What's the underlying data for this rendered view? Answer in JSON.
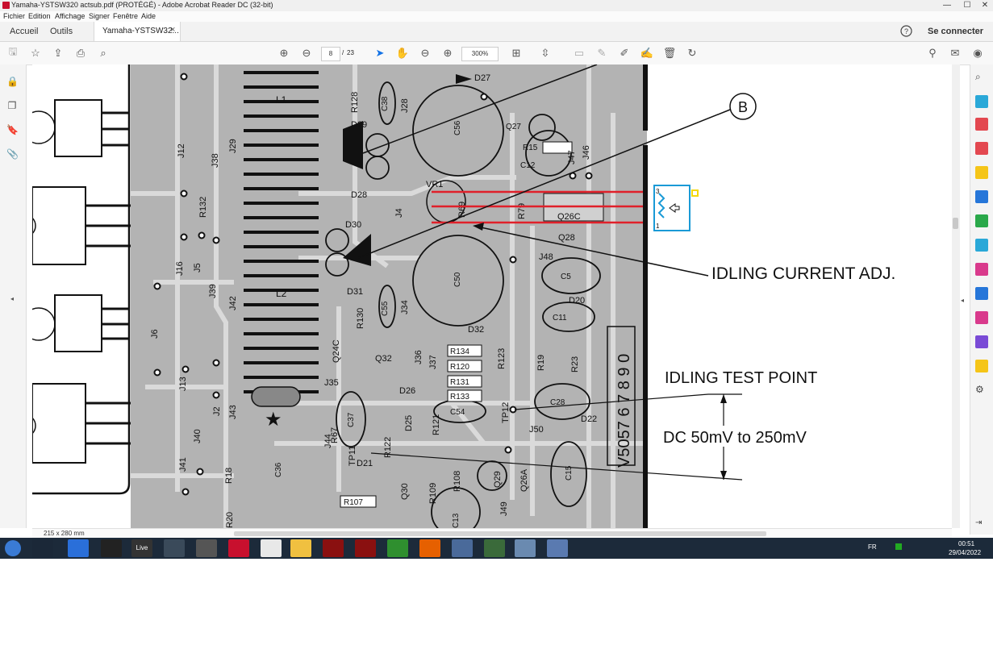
{
  "window": {
    "title": "Yamaha-YSTSW320 actsub.pdf (PROTÉGÉ) - Adobe Acrobat Reader DC (32-bit)",
    "minimize": "—",
    "maximize": "☐",
    "close": "✕"
  },
  "menu": [
    "Fichier",
    "Edition",
    "Affichage",
    "Signer",
    "Fenêtre",
    "Aide"
  ],
  "tabs": {
    "home": "Accueil",
    "tools": "Outils",
    "document": "Yamaha-YSTSW32...",
    "document_close": "×",
    "help_icon": "help-icon",
    "signin": "Se connecter"
  },
  "toolbar": {
    "current_page": "8",
    "page_sep": "/",
    "total_pages": "23",
    "zoom": "300%",
    "icons": [
      "save-icon",
      "bookmark-star-icon",
      "cloud-upload-icon",
      "print-icon",
      "search-zoom-icon",
      "page-up-icon",
      "page-down-icon",
      "select-cursor-icon",
      "hand-tool-icon",
      "zoom-out-icon",
      "zoom-in-icon",
      "page-fit-icon",
      "scroll-mode-icon",
      "comment-icon",
      "highlight-icon",
      "draw-icon",
      "sign-icon",
      "delete-icon",
      "rotate-icon",
      "share-icon",
      "mail-icon",
      "account-icon"
    ]
  },
  "status": {
    "page_size": "215 x 280 mm"
  },
  "schematic": {
    "labels": {
      "b_marker": "B",
      "idling_adj": "IDLING CURRENT ADJ.",
      "idling_tp": "IDLING TEST POINT",
      "dc_range": "DC 50mV to 250mV",
      "vr1": "VR1",
      "pin3": "3",
      "pin1": "1",
      "star": "★",
      "serial": "V5057 6 7 8 9 0",
      "q26c": "Q26C"
    },
    "components": [
      "L1",
      "L2",
      "C56",
      "C50",
      "D29",
      "D28",
      "D30",
      "D31",
      "J4",
      "J12",
      "J16",
      "J6",
      "J5",
      "J38",
      "J39",
      "J29",
      "J42",
      "J13",
      "J2",
      "J43",
      "J40",
      "J41",
      "R132",
      "R128",
      "C38",
      "J28",
      "Q27",
      "R15",
      "C12",
      "J47",
      "J46",
      "Q28",
      "J48",
      "C5",
      "D20",
      "C11",
      "R69",
      "R79",
      "R19",
      "R23",
      "C28",
      "D22",
      "TP12",
      "J50",
      "C15",
      "Q26A",
      "Q29",
      "J49",
      "C13",
      "R108",
      "R109",
      "Q30",
      "R107",
      "D21",
      "TP11",
      "R122",
      "D25",
      "R121",
      "C54",
      "R133",
      "R131",
      "R120",
      "R134",
      "R123",
      "J37",
      "J36",
      "Q32",
      "D26",
      "C55",
      "J34",
      "R130",
      "D27",
      "J35",
      "Q24C",
      "C37",
      "J44",
      "R67",
      "C36",
      "R18",
      "R20",
      "D32"
    ]
  },
  "taskbar": {
    "language": "FR",
    "time": "00:51",
    "date": "29/04/2022",
    "apps": [
      "start-orb",
      "steam",
      "edge-like",
      "corsair",
      "live",
      "settings-gear",
      "msi-afterburner",
      "acrobat",
      "clock",
      "explorer",
      "gpu-z",
      "gpu-z-2",
      "nvidia",
      "firefox",
      "network",
      "desktop-1",
      "desktop-2",
      "desktop-3"
    ]
  }
}
